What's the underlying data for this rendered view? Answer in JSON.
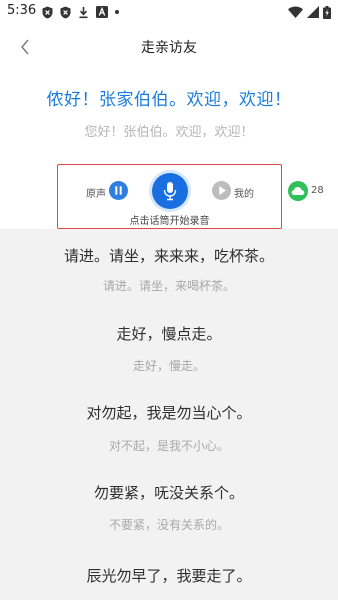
{
  "status_bar": {
    "time": "5:36",
    "left_icons": [
      "shield-x-icon",
      "shield-x-icon",
      "download-icon",
      "a-box-icon",
      "dot-icon"
    ],
    "right_icons": [
      "wifi-icon",
      "signal-icon",
      "battery-icon"
    ]
  },
  "nav": {
    "title": "走亲访友",
    "back_icon": "chevron-left-icon"
  },
  "current": {
    "sentence": "侬好！张家伯伯。欢迎，欢迎！",
    "translation": "您好！张伯伯。欢迎，欢迎！"
  },
  "recorder": {
    "original_label": "原声",
    "my_label": "我的",
    "hint": "点击话筒开始录音",
    "orig_icon": "pause-icon",
    "mic_icon": "microphone-icon",
    "my_icon": "play-icon"
  },
  "badge": {
    "icon": "cloud-icon",
    "count": "28"
  },
  "phrases": [
    {
      "sentence": "请进。请坐，来来来，吃杯茶。",
      "translation": "请进。请坐，来喝杯茶。"
    },
    {
      "sentence": "走好，慢点走。",
      "translation": "走好，慢走。"
    },
    {
      "sentence": "对勿起，我是勿当心个。",
      "translation": "对不起，是我不小心。"
    },
    {
      "sentence": "勿要紧，呒没关系个。",
      "translation": "不要紧，没有关系的。"
    },
    {
      "sentence": "辰光勿早了，我要走了。",
      "translation": ""
    }
  ],
  "colors": {
    "accent": "#1a7ce0",
    "highlight_border": "#e24545",
    "cloud_green": "#2fc05a",
    "list_bg": "#f2f2f2"
  }
}
